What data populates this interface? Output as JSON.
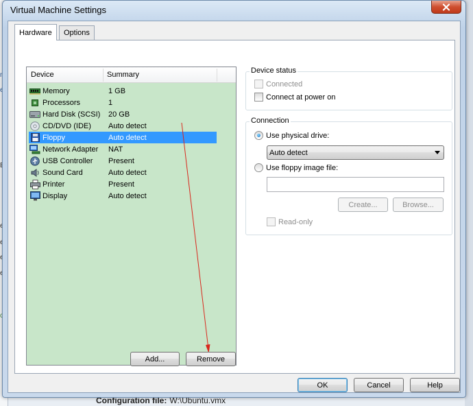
{
  "window": {
    "title": "Virtual Machine Settings"
  },
  "tabs": [
    {
      "label": "Hardware",
      "active": true
    },
    {
      "label": "Options",
      "active": false
    }
  ],
  "device_list": {
    "columns": {
      "device": "Device",
      "summary": "Summary"
    },
    "rows": [
      {
        "device": "Memory",
        "summary": "1 GB",
        "icon": "memory-icon"
      },
      {
        "device": "Processors",
        "summary": "1",
        "icon": "processor-icon"
      },
      {
        "device": "Hard Disk (SCSI)",
        "summary": "20 GB",
        "icon": "hard-disk-icon"
      },
      {
        "device": "CD/DVD (IDE)",
        "summary": "Auto detect",
        "icon": "cd-dvd-icon"
      },
      {
        "device": "Floppy",
        "summary": "Auto detect",
        "icon": "floppy-icon",
        "selected": true
      },
      {
        "device": "Network Adapter",
        "summary": "NAT",
        "icon": "network-adapter-icon"
      },
      {
        "device": "USB Controller",
        "summary": "Present",
        "icon": "usb-icon"
      },
      {
        "device": "Sound Card",
        "summary": "Auto detect",
        "icon": "sound-card-icon"
      },
      {
        "device": "Printer",
        "summary": "Present",
        "icon": "printer-icon"
      },
      {
        "device": "Display",
        "summary": "Auto detect",
        "icon": "display-icon"
      }
    ]
  },
  "list_buttons": {
    "add": "Add...",
    "remove": "Remove"
  },
  "device_status": {
    "label": "Device status",
    "connected": "Connected",
    "connect_at_power_on": "Connect at power on"
  },
  "connection": {
    "label": "Connection",
    "use_physical_drive": "Use physical drive:",
    "drive_value": "Auto detect",
    "use_floppy_image": "Use floppy image file:",
    "image_path_value": "",
    "create_button": "Create...",
    "browse_button": "Browse...",
    "read_only": "Read-only"
  },
  "footer": {
    "ok": "OK",
    "cancel": "Cancel",
    "help": "Help"
  },
  "background": {
    "side_letters": [
      "m",
      "e",
      "a",
      "E",
      "e",
      "e",
      "e",
      "e",
      "c"
    ],
    "config_label": "Configuration file:",
    "config_value": "W:\\Ubuntu.vmx"
  },
  "colors": {
    "selection": "#3399ff",
    "list_background": "#c8e6c9",
    "annotation_arrow": "#d9261c",
    "close_button": "#c9472a"
  }
}
